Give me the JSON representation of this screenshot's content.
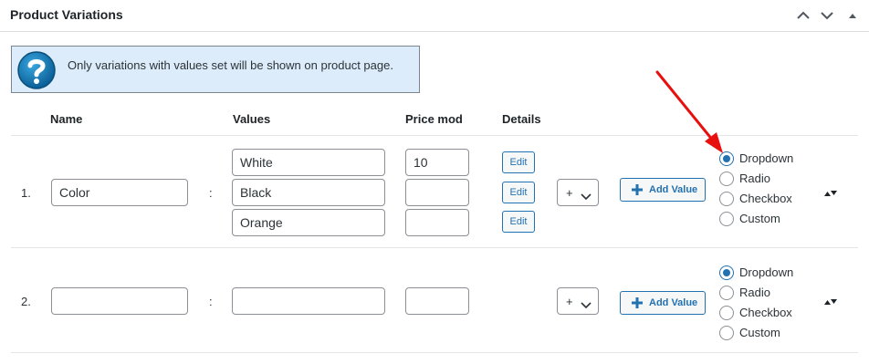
{
  "panel": {
    "title": "Product Variations",
    "controls": [
      "chevron-up-icon",
      "chevron-down-icon",
      "triangle-up-icon"
    ]
  },
  "notice": {
    "icon": "question-icon",
    "text": "Only variations with values set will be shown on product page."
  },
  "columns": {
    "name": "Name",
    "values": "Values",
    "price_mod": "Price mod",
    "details": "Details"
  },
  "rows": [
    {
      "number": "1.",
      "separator": ":",
      "name_value": "Color",
      "values": [
        {
          "value": "White",
          "price": "10",
          "edit_label": "Edit"
        },
        {
          "value": "Black",
          "price": "",
          "edit_label": "Edit"
        },
        {
          "value": "Orange",
          "price": "",
          "edit_label": "Edit"
        }
      ],
      "modifier": "+",
      "add_value_label": "Add Value",
      "display_types": [
        "Dropdown",
        "Radio",
        "Checkbox",
        "Custom"
      ],
      "selected_display": "Dropdown"
    },
    {
      "number": "2.",
      "separator": ":",
      "name_value": "",
      "values": [
        {
          "value": "",
          "price": ""
        }
      ],
      "modifier": "+",
      "add_value_label": "Add Value",
      "display_types": [
        "Dropdown",
        "Radio",
        "Checkbox",
        "Custom"
      ],
      "selected_display": "Dropdown"
    }
  ],
  "colors": {
    "accent": "#2271b1",
    "notice_bg": "#dcecfa",
    "annotation_arrow": "#e8100f"
  }
}
